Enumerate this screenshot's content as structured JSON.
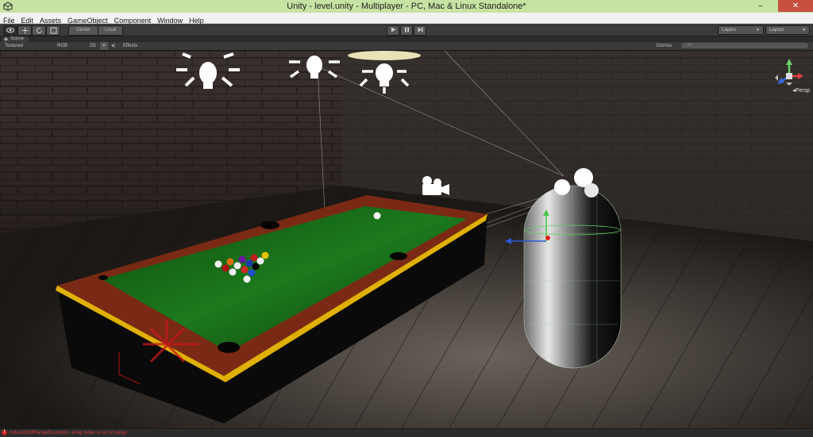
{
  "window": {
    "title": "Unity - level.unity - Multiplayer - PC, Mac & Linux Standalone*",
    "minimize_glyph": "–",
    "maximize_glyph": "☐",
    "close_glyph": "✕"
  },
  "menu": [
    "File",
    "Edit",
    "Assets",
    "GameObject",
    "Component",
    "Window",
    "Help"
  ],
  "toolbar": {
    "pivot_label": "Center",
    "space_label": "Local",
    "layers_label": "Layers",
    "layout_label": "Layout"
  },
  "scene_tab": {
    "label": "Scene"
  },
  "scene_bar": {
    "render_mode": "Textured",
    "color_mode": "RGB",
    "mode_2d": "2D",
    "effects_label": "Effects",
    "gizmos_label": "Gizmos",
    "search_placeholder": "All"
  },
  "gizmo": {
    "projection_label": "Persp",
    "y_label": "y",
    "x_label": "x",
    "z_label": "z"
  },
  "status": {
    "message": "IndexOutOfRangeException: Array index is out of range.",
    "error_glyph": "!"
  },
  "colors": {
    "titlebar": "#c7e3a3",
    "felt": "#1a6b1a",
    "rail": "#7a2a14",
    "error": "#d93b3b"
  }
}
